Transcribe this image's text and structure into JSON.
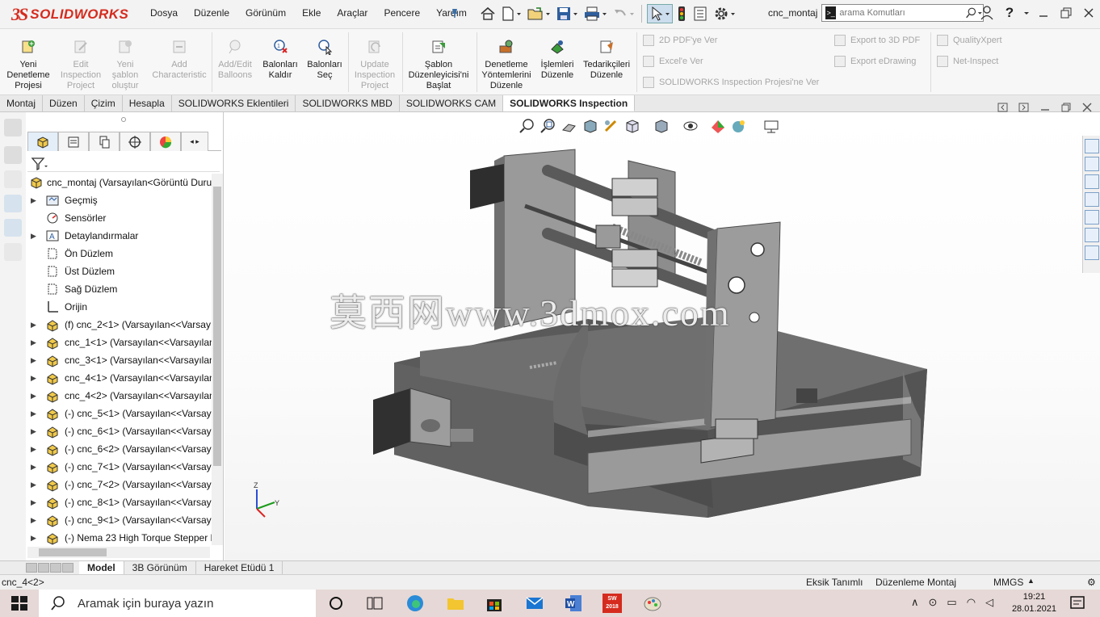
{
  "app": {
    "brand_ds": "3S",
    "brand_name": "SOLIDWORKS",
    "document": "cnc_montaj"
  },
  "menu": [
    "Dosya",
    "Düzenle",
    "Görünüm",
    "Ekle",
    "Araçlar",
    "Pencere",
    "Yardım"
  ],
  "search": {
    "placeholder": "arama Komutları"
  },
  "ribbon": {
    "buttons": [
      {
        "label": "Yeni\nDenetleme\nProjesi",
        "enabled": true
      },
      {
        "label": "Edit\nInspection\nProject",
        "enabled": false
      },
      {
        "label": "Yeni\nşablon\noluştur",
        "enabled": false
      },
      {
        "label": "Add\nCharacteristic",
        "enabled": false
      },
      {
        "label": "Add/Edit\nBalloons",
        "enabled": false
      },
      {
        "label": "Balonları\nKaldır",
        "enabled": true
      },
      {
        "label": "Balonları\nSeç",
        "enabled": true
      },
      {
        "label": "Update\nInspection\nProject",
        "enabled": false
      },
      {
        "label": "Şablon\nDüzenleyicisi'ni\nBaşlat",
        "enabled": true
      },
      {
        "label": "Denetleme\nYöntemlerini\nDüzenle",
        "enabled": true
      },
      {
        "label": "İşlemleri\nDüzenle",
        "enabled": true
      },
      {
        "label": "Tedarikçileri\nDüzenle",
        "enabled": true
      }
    ],
    "small": [
      "2D PDF'ye Ver",
      "Excel'e Ver",
      "SOLIDWORKS Inspection Projesi'ne Ver",
      "Export to 3D PDF",
      "Export eDrawing",
      "QualityXpert",
      "Net-Inspect"
    ]
  },
  "tabs": [
    "Montaj",
    "Düzen",
    "Çizim",
    "Hesapla",
    "SOLIDWORKS Eklentileri",
    "SOLIDWORKS MBD",
    "SOLIDWORKS CAM",
    "SOLIDWORKS Inspection"
  ],
  "active_tab": "SOLIDWORKS Inspection",
  "tree": {
    "root": "cnc_montaj  (Varsayılan<Görüntü Duru",
    "items": [
      {
        "label": "Geçmiş",
        "icon": "history-folder-icon",
        "expand": true
      },
      {
        "label": "Sensörler",
        "icon": "sensor-icon",
        "expand": false
      },
      {
        "label": "Detaylandırmalar",
        "icon": "annotation-icon",
        "expand": true
      },
      {
        "label": "Ön Düzlem",
        "icon": "plane-icon",
        "expand": false
      },
      {
        "label": "Üst Düzlem",
        "icon": "plane-icon",
        "expand": false
      },
      {
        "label": "Sağ Düzlem",
        "icon": "plane-icon",
        "expand": false
      },
      {
        "label": "Orijin",
        "icon": "origin-icon",
        "expand": false
      },
      {
        "label": "(f) cnc_2<1> (Varsayılan<<Varsayı",
        "icon": "part-icon",
        "expand": true
      },
      {
        "label": "cnc_1<1> (Varsayılan<<Varsayılan",
        "icon": "part-icon",
        "expand": true
      },
      {
        "label": "cnc_3<1> (Varsayılan<<Varsayılan",
        "icon": "part-icon",
        "expand": true
      },
      {
        "label": "cnc_4<1> (Varsayılan<<Varsayılan",
        "icon": "part-icon",
        "expand": true
      },
      {
        "label": "cnc_4<2> (Varsayılan<<Varsayılan",
        "icon": "part-icon",
        "expand": true
      },
      {
        "label": "(-) cnc_5<1> (Varsayılan<<Varsayı",
        "icon": "part-icon",
        "expand": true
      },
      {
        "label": "(-) cnc_6<1> (Varsayılan<<Varsayı",
        "icon": "part-icon",
        "expand": true
      },
      {
        "label": "(-) cnc_6<2> (Varsayılan<<Varsayı",
        "icon": "part-icon",
        "expand": true
      },
      {
        "label": "(-) cnc_7<1> (Varsayılan<<Varsayı",
        "icon": "part-icon",
        "expand": true
      },
      {
        "label": "(-) cnc_7<2> (Varsayılan<<Varsayı",
        "icon": "part-icon",
        "expand": true
      },
      {
        "label": "(-) cnc_8<1> (Varsayılan<<Varsayı",
        "icon": "part-icon",
        "expand": true
      },
      {
        "label": "(-) cnc_9<1> (Varsayılan<<Varsayı",
        "icon": "part-icon",
        "expand": true
      },
      {
        "label": "(-) Nema 23 High Torque Stepper N",
        "icon": "part-icon",
        "expand": true
      }
    ]
  },
  "watermark": "莫西网www.3dmox.com",
  "bottom_tabs": [
    "Model",
    "3B Görünüm",
    "Hareket Etüdü 1"
  ],
  "active_bottom_tab": "Model",
  "status": {
    "selection": "cnc_4<2>",
    "defined": "Eksik Tanımlı",
    "mode": "Düzenleme Montaj",
    "units": "MMGS"
  },
  "taskbar": {
    "search_placeholder": "Aramak için buraya yazın",
    "time": "19:21",
    "date": "28.01.2021",
    "sw_badge": "2018"
  },
  "colors": {
    "brand_red": "#d52b1e",
    "part_gray": "#6b6b6b",
    "plate_gray": "#9a9a9a",
    "taskbar": "#e6d8d6"
  }
}
